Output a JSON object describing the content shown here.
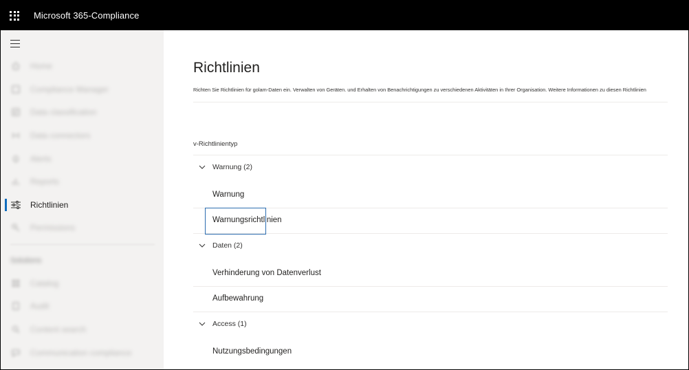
{
  "header": {
    "app_title": "Microsoft 365-Compliance",
    "waffle_icon": "app-launcher-icon"
  },
  "nav": {
    "menu_icon": "hamburger-icon",
    "items": [
      {
        "label": "Home",
        "icon": "home-icon",
        "blurred": true
      },
      {
        "label": "Compliance Manager",
        "icon": "compliance-manager-icon",
        "blurred": true
      },
      {
        "label": "Data classification",
        "icon": "data-classification-icon",
        "blurred": true
      },
      {
        "label": "Data connectors",
        "icon": "data-connectors-icon",
        "blurred": true
      },
      {
        "label": "Alerts",
        "icon": "alerts-icon",
        "blurred": true
      },
      {
        "label": "Reports",
        "icon": "reports-icon",
        "blurred": true
      },
      {
        "label": "Richtlinien",
        "icon": "policies-sliders-icon",
        "blurred": false,
        "active": true
      },
      {
        "label": "Permissions",
        "icon": "permissions-icon",
        "blurred": true
      }
    ],
    "section_label": "Solutions",
    "solution_items": [
      {
        "label": "Catalog",
        "icon": "catalog-icon"
      },
      {
        "label": "Audit",
        "icon": "audit-icon"
      },
      {
        "label": "Content search",
        "icon": "content-search-icon"
      },
      {
        "label": "Communication compliance",
        "icon": "communication-compliance-icon"
      }
    ],
    "accent_color": "#0f6cbd"
  },
  "main": {
    "title": "Richtlinien",
    "description": "Richten Sie Richtlinien für golam-Daten ein. Verwalten von Geräten. und Erhalten von Benachrichtigungen zu verschiedenen Aktivitäten in Ihrer Organisation. Weitere Informationen zu diesen Richtlinien",
    "column_header": "v-Richtlinientyp",
    "groups": [
      {
        "label": "Warnung (2)",
        "items": [
          "Warnung",
          "Warnungsrichtlinien"
        ]
      },
      {
        "label": "Daten (2)",
        "items": [
          "Verhinderung von Datenverlust",
          "Aufbewahrung"
        ]
      },
      {
        "label": "Access (1)",
        "items": [
          "Nutzungsbedingungen"
        ]
      }
    ]
  }
}
